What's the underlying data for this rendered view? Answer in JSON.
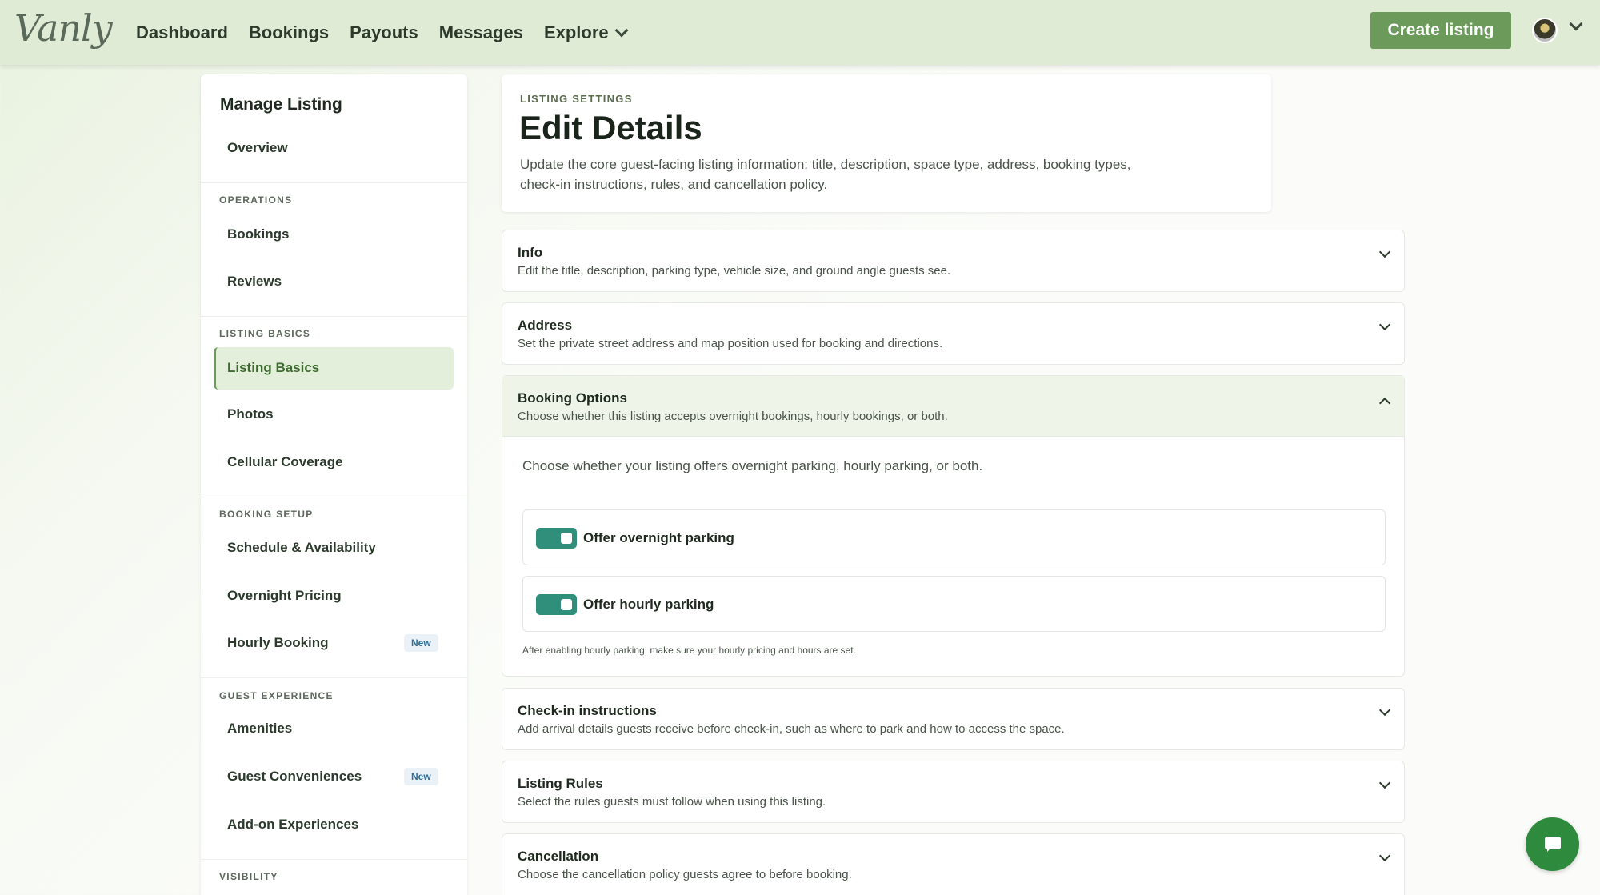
{
  "brand": {
    "logo_text": "Vanly"
  },
  "nav": {
    "links": [
      "Dashboard",
      "Bookings",
      "Payouts",
      "Messages",
      "Explore"
    ],
    "create_label": "Create listing"
  },
  "sidebar": {
    "title": "Manage Listing",
    "overview": "Overview",
    "sections": {
      "operations": "OPERATIONS",
      "listing_basics": "LISTING BASICS",
      "booking_setup": "BOOKING SETUP",
      "guest_experience": "GUEST EXPERIENCE",
      "visibility": "VISIBILITY"
    },
    "items": {
      "bookings": "Bookings",
      "reviews": "Reviews",
      "listing_basics": "Listing Basics",
      "photos": "Photos",
      "cellular": "Cellular Coverage",
      "schedule": "Schedule & Availability",
      "overnight_pricing": "Overnight Pricing",
      "hourly_booking": "Hourly Booking",
      "amenities": "Amenities",
      "guest_conveniences": "Guest Conveniences",
      "addons": "Add-on Experiences"
    },
    "badge_new": "New"
  },
  "header": {
    "eyebrow": "LISTING SETTINGS",
    "title": "Edit Details",
    "description": "Update the core guest-facing listing information: title, description, space type, address, booking types, check-in instructions, rules, and cancellation policy."
  },
  "panels": {
    "info": {
      "title": "Info",
      "sub": "Edit the title, description, parking type, vehicle size, and ground angle guests see."
    },
    "address": {
      "title": "Address",
      "sub": "Set the private street address and map position used for booking and directions."
    },
    "booking": {
      "title": "Booking Options",
      "sub": "Choose whether this listing accepts overnight bookings, hourly bookings, or both.",
      "lead": "Choose whether your listing offers overnight parking, hourly parking, or both.",
      "overnight_label": "Offer overnight parking",
      "overnight_on": true,
      "hourly_label": "Offer hourly parking",
      "hourly_on": true,
      "hint": "After enabling hourly parking, make sure your hourly pricing and hours are set."
    },
    "checkin": {
      "title": "Check-in instructions",
      "sub": "Add arrival details guests receive before check-in, such as where to park and how to access the space."
    },
    "rules": {
      "title": "Listing Rules",
      "sub": "Select the rules guests must follow when using this listing."
    },
    "cancellation": {
      "title": "Cancellation",
      "sub": "Choose the cancellation policy guests agree to before booking."
    }
  },
  "colors": {
    "accent": "#6b9a5b",
    "toggle": "#2f8f7a",
    "chat": "#2e8a3d"
  }
}
